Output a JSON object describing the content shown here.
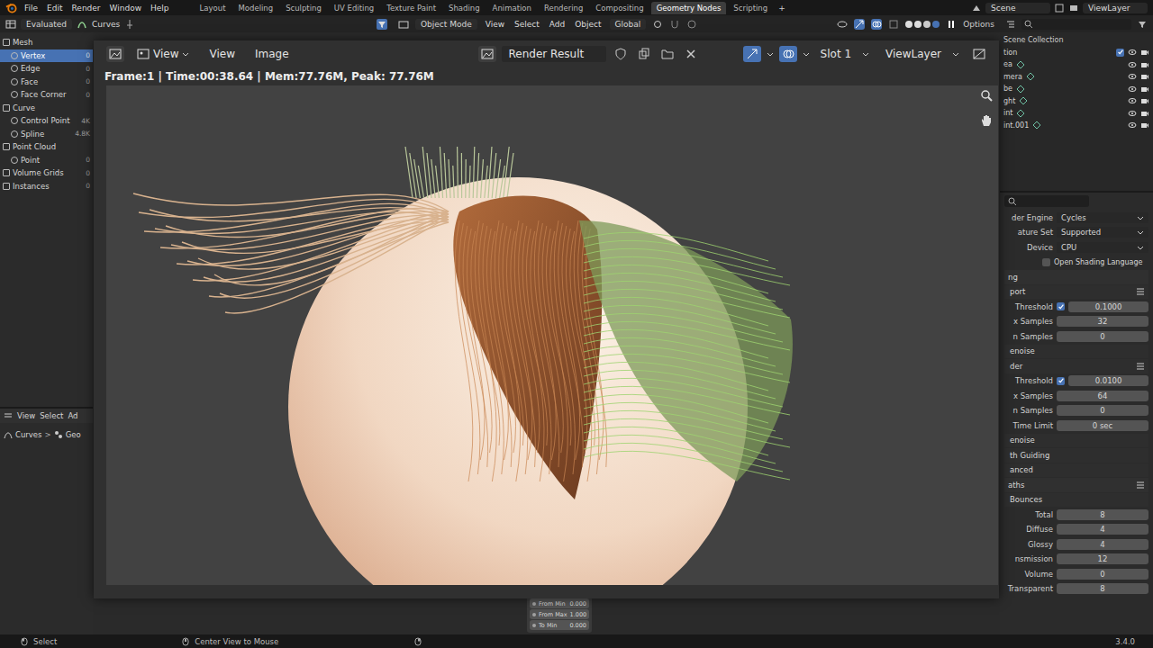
{
  "topbar": {
    "menus": [
      "File",
      "Edit",
      "Render",
      "Window",
      "Help"
    ],
    "workspaces": [
      {
        "label": "Layout",
        "selected": false
      },
      {
        "label": "Modeling",
        "selected": false
      },
      {
        "label": "Sculpting",
        "selected": false
      },
      {
        "label": "UV Editing",
        "selected": false
      },
      {
        "label": "Texture Paint",
        "selected": false
      },
      {
        "label": "Shading",
        "selected": false
      },
      {
        "label": "Animation",
        "selected": false
      },
      {
        "label": "Rendering",
        "selected": false
      },
      {
        "label": "Compositing",
        "selected": false
      },
      {
        "label": "Geometry Nodes",
        "selected": true
      },
      {
        "label": "Scripting",
        "selected": false
      }
    ],
    "add": "+",
    "scene": "Scene",
    "view_layer": "ViewLayer"
  },
  "editor_header": {
    "evaluated": "Evaluated",
    "curves": "Curves",
    "mode": "Object Mode",
    "menus": [
      "View",
      "Select",
      "Add",
      "Object"
    ],
    "orientation": "Global",
    "options": "Options"
  },
  "spreadsheet": {
    "items": [
      {
        "label": "Mesh",
        "kind": "group",
        "count": "",
        "selected": false
      },
      {
        "label": "Vertex",
        "kind": "item",
        "count": "0",
        "selected": true
      },
      {
        "label": "Edge",
        "kind": "item",
        "count": "0",
        "selected": false
      },
      {
        "label": "Face",
        "kind": "item",
        "count": "0",
        "selected": false
      },
      {
        "label": "Face Corner",
        "kind": "item",
        "count": "0",
        "selected": false
      },
      {
        "label": "Curve",
        "kind": "group",
        "count": "",
        "selected": false
      },
      {
        "label": "Control Point",
        "kind": "item",
        "count": "4K",
        "selected": false
      },
      {
        "label": "Spline",
        "kind": "item",
        "count": "4.8K",
        "selected": false
      },
      {
        "label": "Point Cloud",
        "kind": "group",
        "count": "",
        "selected": false
      },
      {
        "label": "Point",
        "kind": "item",
        "count": "0",
        "selected": false
      },
      {
        "label": "Volume Grids",
        "kind": "group",
        "count": "0",
        "selected": false
      },
      {
        "label": "Instances",
        "kind": "group",
        "count": "0",
        "selected": false
      }
    ]
  },
  "lower_left": {
    "menus": [
      "View",
      "Select",
      "Ad"
    ],
    "breadcrumb": [
      "Curves",
      "Geo"
    ],
    "separator": ">"
  },
  "render_window": {
    "menus": [
      "View",
      "View",
      "Image"
    ],
    "image": "Render Result",
    "slot": "Slot 1",
    "layer": "ViewLayer",
    "info": "Frame:1 | Time:00:38.64 | Mem:77.76M, Peak: 77.76M"
  },
  "outliner": {
    "title": "Scene Collection",
    "collection": {
      "label": "tion",
      "checked": true
    },
    "objects": [
      {
        "label": "ea"
      },
      {
        "label": "mera"
      },
      {
        "label": "be"
      },
      {
        "label": "ght"
      },
      {
        "label": "int"
      },
      {
        "label": "int.001"
      }
    ]
  },
  "properties": {
    "rows": [
      {
        "kind": "dropdown",
        "label": "der Engine",
        "value": "Cycles"
      },
      {
        "kind": "dropdown",
        "label": "ature Set",
        "value": "Supported"
      },
      {
        "kind": "dropdown",
        "label": "Device",
        "value": "CPU"
      },
      {
        "kind": "checkbox",
        "label": "Open Shading Language",
        "checked": false
      },
      {
        "kind": "section",
        "label": "ng",
        "presets": false
      },
      {
        "kind": "subsection",
        "label": "port",
        "presets": true
      },
      {
        "kind": "checkfield",
        "label": "Threshold",
        "checked": true,
        "value": "0.1000"
      },
      {
        "kind": "field",
        "label": "x Samples",
        "value": "32"
      },
      {
        "kind": "field",
        "label": "n Samples",
        "value": "0"
      },
      {
        "kind": "subsection",
        "label": "enoise",
        "presets": false
      },
      {
        "kind": "subsection",
        "label": "der",
        "presets": true
      },
      {
        "kind": "checkfield",
        "label": "Threshold",
        "checked": true,
        "value": "0.0100"
      },
      {
        "kind": "field",
        "label": "x Samples",
        "value": "64"
      },
      {
        "kind": "field",
        "label": "n Samples",
        "value": "0"
      },
      {
        "kind": "field",
        "label": "Time Limit",
        "value": "0 sec"
      },
      {
        "kind": "subsection",
        "label": "enoise",
        "presets": false
      },
      {
        "kind": "subsection",
        "label": "th Guiding",
        "presets": false
      },
      {
        "kind": "subsection",
        "label": "anced",
        "presets": false
      },
      {
        "kind": "section",
        "label": "aths",
        "presets": true
      },
      {
        "kind": "subsection",
        "label": "Bounces",
        "presets": false
      },
      {
        "kind": "field",
        "label": "Total",
        "value": "8"
      },
      {
        "kind": "field",
        "label": "Diffuse",
        "value": "4"
      },
      {
        "kind": "field",
        "label": "Glossy",
        "value": "4"
      },
      {
        "kind": "field",
        "label": "nsmission",
        "value": "12"
      },
      {
        "kind": "field",
        "label": "Volume",
        "value": "0"
      },
      {
        "kind": "field",
        "label": "Transparent",
        "value": "8"
      }
    ]
  },
  "node_fields": [
    {
      "label": "From Min",
      "value": "0.000"
    },
    {
      "label": "From Max",
      "value": "1.000"
    },
    {
      "label": "To Min",
      "value": "0.000"
    }
  ],
  "status_bar": {
    "left": "Select",
    "middle": "Center View to Mouse",
    "version": "3.4.0"
  }
}
